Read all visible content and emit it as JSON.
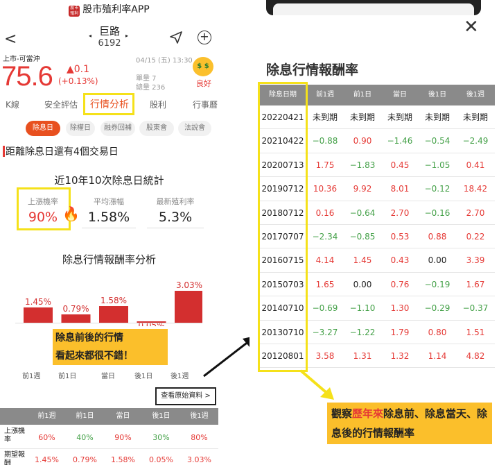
{
  "app": {
    "title": "股市殖利率APP",
    "logo_text": "股市殖利率"
  },
  "stock": {
    "name": "巨路",
    "code": "6192",
    "market": "上市-可當沖",
    "datetime": "04/15 (五) 13:30",
    "price": "75.6",
    "change": "▲0.1",
    "change_pct": "(+0.13%)",
    "volume": "單量 7",
    "total_volume": "總量 236",
    "mood": "良好",
    "mood_icon_text": "$ $"
  },
  "tabs": [
    "K線",
    "安全評估",
    "行情分析",
    "股利",
    "行事曆"
  ],
  "subtabs": [
    "除息日",
    "除權日",
    "融券回補",
    "股東會",
    "法說會"
  ],
  "notice": "距離除息日還有4個交易日",
  "stats": {
    "title": "近10年10次除息日統計",
    "rise_rate_label": "上漲機率",
    "rise_rate": "90%",
    "avg_label": "平均漲幅",
    "avg": "1.58%",
    "yield_label": "最新殖利率",
    "yield": "5.3%"
  },
  "analysis_title": "除息行情報酬率分析",
  "chart_data": {
    "type": "bar",
    "categories": [
      "前1週",
      "前1日",
      "當日",
      "後1日",
      "後1週"
    ],
    "values": [
      1.45,
      0.79,
      1.58,
      0.05,
      3.03
    ],
    "value_labels": [
      "1.45%",
      "0.79%",
      "1.58%",
      "0.05%",
      "3.03%"
    ],
    "ylim": [
      0,
      3.03
    ],
    "color": "#d32f2f"
  },
  "overlay_left": [
    "除息前後的行情",
    "看起來都很不錯！"
  ],
  "view_raw": "查看原始資料 >",
  "summary": {
    "headers": [
      "前1週",
      "前1日",
      "當日",
      "後1日",
      "後1週"
    ],
    "rows": [
      {
        "label": "上漲機率",
        "values": [
          "60%",
          "40%",
          "90%",
          "30%",
          "80%"
        ]
      },
      {
        "label": "期望報酬",
        "values": [
          "1.45%",
          "0.79%",
          "1.58%",
          "0.05%",
          "3.03%"
        ]
      }
    ]
  },
  "right": {
    "title": "除息行情報酬率",
    "headers": [
      "除息日期",
      "前1週",
      "前1日",
      "當日",
      "後1日",
      "後1週"
    ],
    "rows": [
      {
        "date": "20220421",
        "values": [
          "未到期",
          "未到期",
          "未到期",
          "未到期",
          "未到期"
        ]
      },
      {
        "date": "20210422",
        "values": [
          "−0.88",
          "0.90",
          "−1.46",
          "−0.54",
          "−2.49"
        ]
      },
      {
        "date": "20200713",
        "values": [
          "1.75",
          "−1.83",
          "0.45",
          "−1.05",
          "0.41"
        ]
      },
      {
        "date": "20190712",
        "values": [
          "10.36",
          "9.92",
          "8.01",
          "−0.12",
          "18.42"
        ]
      },
      {
        "date": "20180712",
        "values": [
          "0.16",
          "−0.64",
          "2.70",
          "−0.16",
          "2.70"
        ]
      },
      {
        "date": "20170707",
        "values": [
          "−2.34",
          "−0.85",
          "0.53",
          "0.88",
          "0.22"
        ]
      },
      {
        "date": "20160715",
        "values": [
          "4.14",
          "1.45",
          "0.43",
          "0.00",
          "3.39"
        ]
      },
      {
        "date": "20150703",
        "values": [
          "1.65",
          "0.00",
          "0.76",
          "−0.19",
          "1.67"
        ]
      },
      {
        "date": "20140710",
        "values": [
          "−0.69",
          "−1.10",
          "1.30",
          "−0.29",
          "−0.37"
        ]
      },
      {
        "date": "20130710",
        "values": [
          "−3.27",
          "−1.22",
          "1.79",
          "0.80",
          "1.51"
        ]
      },
      {
        "date": "20120801",
        "values": [
          "3.58",
          "1.31",
          "1.32",
          "1.14",
          "4.82"
        ]
      }
    ],
    "note_parts": [
      "觀察",
      "歷年來",
      "除息前、除息當天、除息後的行情報酬率"
    ]
  }
}
